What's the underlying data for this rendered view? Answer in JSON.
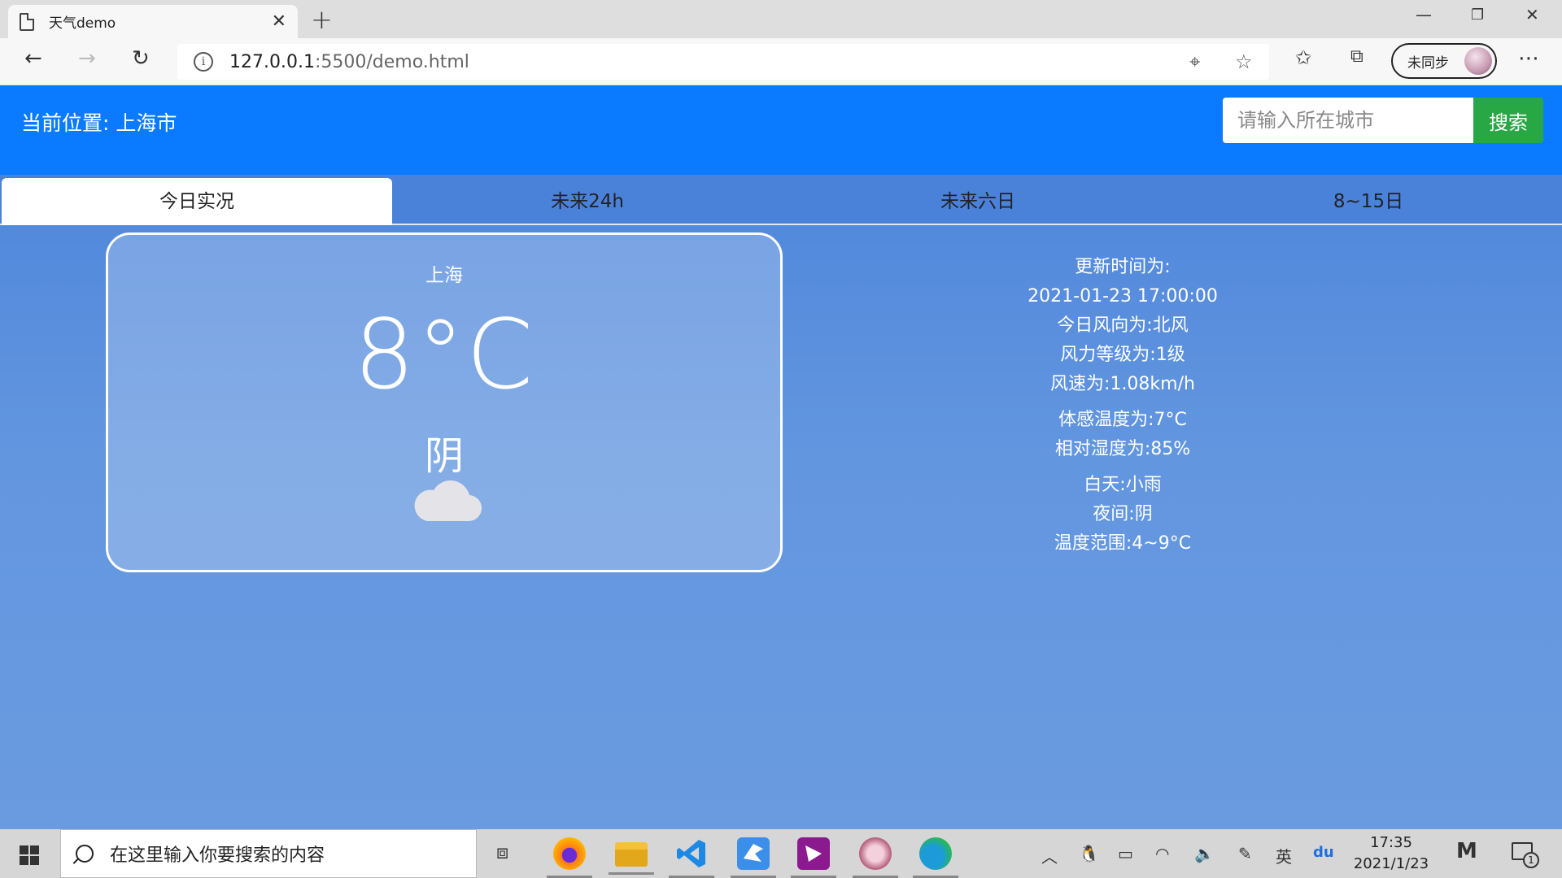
{
  "browser": {
    "tab_title": "天气demo",
    "url_host": "127.0.0.1",
    "url_path": ":5500/demo.html",
    "profile_label": "未同步"
  },
  "header": {
    "location_prefix": "当前位置:",
    "location_city": "上海市",
    "search_placeholder": "请输入所在城市",
    "search_button": "搜索"
  },
  "tabs": [
    {
      "label": "今日实况",
      "active": true
    },
    {
      "label": "未来24h",
      "active": false
    },
    {
      "label": "未来六日",
      "active": false
    },
    {
      "label": "8~15日",
      "active": false
    }
  ],
  "current": {
    "city": "上海",
    "temperature": "8°C",
    "condition": "阴",
    "icon": "cloud-icon"
  },
  "details": {
    "update_label": "更新时间为:",
    "update_time": "2021-01-23 17:00:00",
    "wind_direction": "今日风向为:北风",
    "wind_level": "风力等级为:1级",
    "wind_speed": "风速为:1.08km/h",
    "feels_like": "体感温度为:7°C",
    "humidity": "相对湿度为:85%",
    "day": "白天:小雨",
    "night": "夜间:阴",
    "temp_range": "温度范围:4~9°C"
  },
  "taskbar": {
    "search_placeholder": "在这里输入你要搜索的内容",
    "ime": "英",
    "time": "17:35",
    "date": "2021/1/23",
    "notification_count": "1"
  },
  "colors": {
    "nav_blue": "#0a7bff",
    "search_green": "#28a745",
    "page_blue": "#4a82da"
  }
}
